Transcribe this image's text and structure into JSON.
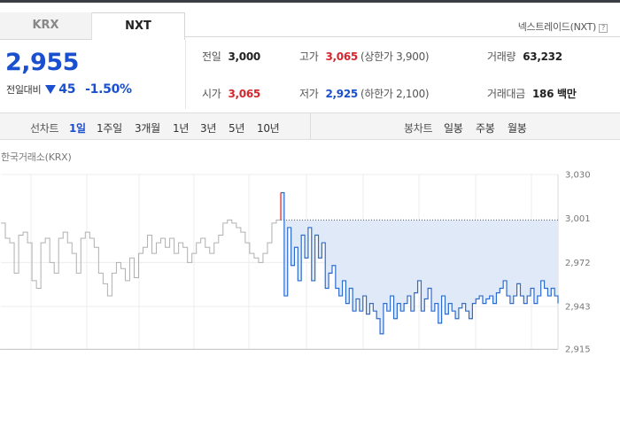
{
  "tabs": [
    {
      "label": "KRX"
    },
    {
      "label": "NXT"
    }
  ],
  "nxt_label": "넥스트레이드(NXT)",
  "help_icon": "?",
  "price": {
    "current": "2,955",
    "change_label": "전일대비",
    "change_amount": "45",
    "change_pct": "-1.50%",
    "direction": "down"
  },
  "stats": {
    "prev_close": {
      "label": "전일",
      "value": "3,000"
    },
    "open": {
      "label": "시가",
      "value": "3,065"
    },
    "high": {
      "label": "고가",
      "value": "3,065",
      "limit_label": "(상한가 3,900)"
    },
    "low": {
      "label": "저가",
      "value": "2,925",
      "limit_label": "(하한가 2,100)"
    },
    "volume": {
      "label": "거래량",
      "value": "63,232"
    },
    "amount": {
      "label": "거래대금",
      "value": "186 백만"
    }
  },
  "period_bar": {
    "line_label": "선차트",
    "line_periods": [
      "1일",
      "1주일",
      "3개월",
      "1년",
      "3년",
      "5년",
      "10년"
    ],
    "line_selected": "1일",
    "candle_label": "봉차트",
    "candle_periods": [
      "일봉",
      "주봉",
      "월봉"
    ]
  },
  "chart_exchange_label": "한국거래소(KRX)",
  "chart_data": {
    "type": "line",
    "title": "",
    "ylabel": "",
    "ylim": [
      2915,
      3030
    ],
    "y_ticks": [
      "3,030",
      "3,001",
      "2,972",
      "2,943",
      "2,915"
    ],
    "grid": true,
    "reference_line": 3000,
    "colors": {
      "previous_day": "#b0b0b0",
      "today": "#2c6bcf",
      "fill": "#dfe9f7",
      "marker": "#e0282b"
    },
    "series": [
      {
        "values_previous_day": [
          2998,
          2988,
          2985,
          2965,
          2990,
          2992,
          2985,
          2960,
          2955,
          2985,
          2988,
          2972,
          2965,
          2988,
          2992,
          2985,
          2978,
          2965,
          2988,
          2992,
          2988,
          2982,
          2965,
          2958,
          2950,
          2965,
          2972,
          2968,
          2960,
          2975,
          2962,
          2978,
          2982,
          2990,
          2978,
          2985,
          2988,
          2982,
          2988,
          2978,
          2985,
          2982,
          2972,
          2978,
          2985,
          2988,
          2982,
          2978,
          2985,
          2990,
          2998,
          3000,
          2998,
          2995,
          2992,
          2985,
          2978,
          2975,
          2972,
          2978,
          2985,
          2998,
          3000
        ],
        "values_today": [
          3018,
          2950,
          2995,
          2970,
          2982,
          2960,
          2990,
          2975,
          2995,
          2960,
          2990,
          2975,
          2985,
          2955,
          2965,
          2970,
          2955,
          2950,
          2960,
          2945,
          2955,
          2940,
          2948,
          2940,
          2950,
          2938,
          2945,
          2940,
          2935,
          2925,
          2945,
          2940,
          2950,
          2935,
          2945,
          2940,
          2945,
          2950,
          2940,
          2952,
          2960,
          2940,
          2948,
          2955,
          2940,
          2945,
          2932,
          2950,
          2938,
          2945,
          2940,
          2935,
          2942,
          2945,
          2940,
          2935,
          2945,
          2948,
          2950,
          2945,
          2948,
          2950,
          2945,
          2952,
          2955,
          2960,
          2950,
          2945,
          2950,
          2958,
          2950,
          2945,
          2950,
          2955,
          2945,
          2950,
          2960,
          2955,
          2950,
          2955,
          2950,
          2945
        ]
      }
    ]
  }
}
